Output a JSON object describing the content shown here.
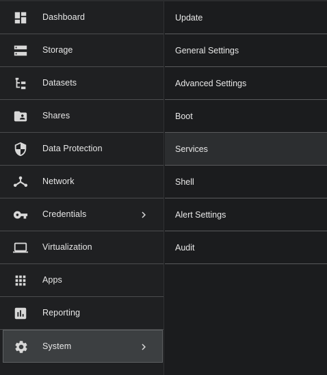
{
  "sidebar": {
    "items": [
      {
        "label": "Dashboard",
        "icon": "dashboard-icon"
      },
      {
        "label": "Storage",
        "icon": "storage-icon"
      },
      {
        "label": "Datasets",
        "icon": "datasets-icon"
      },
      {
        "label": "Shares",
        "icon": "shares-icon"
      },
      {
        "label": "Data Protection",
        "icon": "shield-icon"
      },
      {
        "label": "Network",
        "icon": "network-icon"
      },
      {
        "label": "Credentials",
        "icon": "key-icon",
        "has_submenu": true
      },
      {
        "label": "Virtualization",
        "icon": "laptop-icon"
      },
      {
        "label": "Apps",
        "icon": "apps-grid-icon"
      },
      {
        "label": "Reporting",
        "icon": "reporting-icon"
      },
      {
        "label": "System",
        "icon": "gear-icon",
        "has_submenu": true,
        "active": true
      }
    ]
  },
  "submenu": {
    "items": [
      {
        "label": "Update"
      },
      {
        "label": "General Settings"
      },
      {
        "label": "Advanced Settings"
      },
      {
        "label": "Boot"
      },
      {
        "label": "Services",
        "hovered": true
      },
      {
        "label": "Shell"
      },
      {
        "label": "Alert Settings"
      },
      {
        "label": "Audit"
      }
    ]
  },
  "colors": {
    "background": "#1b1c1e",
    "sidebar_background": "#1f2022",
    "active_item": "#3c3f41",
    "hover_item": "#2c2e30",
    "text": "#e8e8e8",
    "divider": "#4b4c4e"
  }
}
